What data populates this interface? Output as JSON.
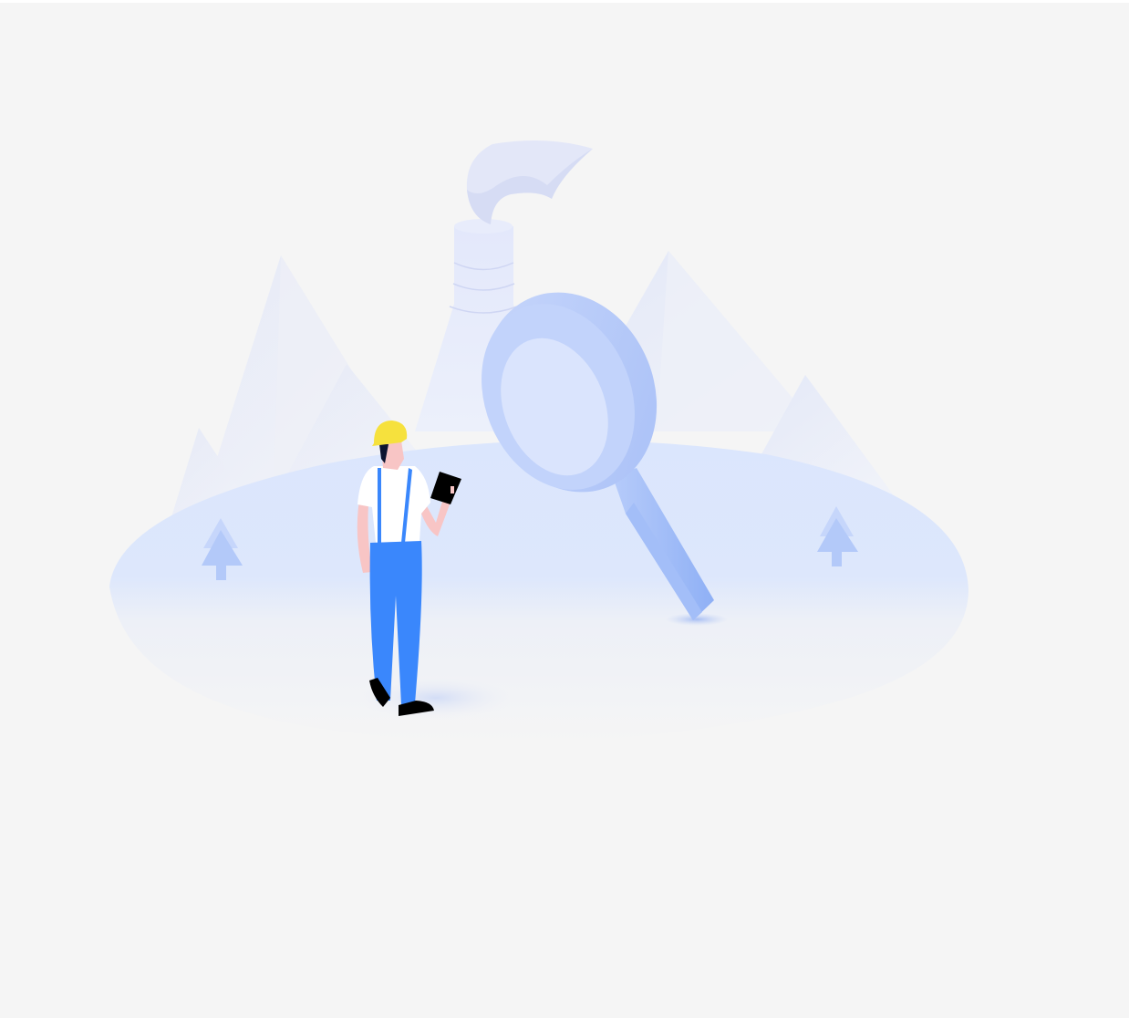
{
  "screen": {
    "state": "empty",
    "background_color": "#f5f5f5"
  },
  "illustration": {
    "name": "engineer-with-magnifier",
    "elements": [
      "mountains-icon",
      "factory-chimney-icon",
      "magnifying-glass-icon",
      "worker-icon",
      "tree-icon"
    ],
    "colors": {
      "ground": "#dce7fd",
      "magnifier": "#b9cdfa",
      "helmet": "#f6e13d",
      "overalls": "#3a87fc",
      "skin": "#f8c5c5",
      "tablet": "#000000"
    }
  }
}
